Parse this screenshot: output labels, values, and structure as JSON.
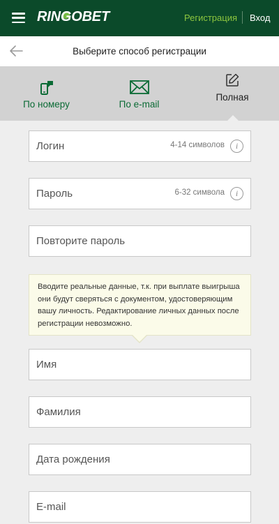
{
  "header": {
    "logo_left": "RIN",
    "logo_o": "GO",
    "logo_right": "BET",
    "register_label": "Регистрация",
    "login_label": "Вход"
  },
  "subheader": {
    "title": "Выберите способ регистрации"
  },
  "tabs": [
    {
      "label": "По номеру",
      "icon": "phone-icon"
    },
    {
      "label": "По e-mail",
      "icon": "envelope-icon"
    },
    {
      "label": "Полная",
      "icon": "edit-icon",
      "active": true
    }
  ],
  "form": {
    "login": {
      "placeholder": "Логин",
      "hint": "4-14 символов"
    },
    "password": {
      "placeholder": "Пароль",
      "hint": "6-32 символа"
    },
    "password_repeat": {
      "placeholder": "Повторите пароль"
    },
    "notice": "Вводите реальные данные, т.к. при выплате выигрыша они будут сверяться с документом, удостоверяющим вашу личность. Редактирование личных данных после регистрации невозможно.",
    "first_name": {
      "placeholder": "Имя"
    },
    "last_name": {
      "placeholder": "Фамилия"
    },
    "birth_date": {
      "placeholder": "Дата рождения"
    },
    "email": {
      "placeholder": "E-mail"
    }
  },
  "colors": {
    "header_bg": "#0b4a2a",
    "accent_green": "#8dc63f",
    "tab_green": "#0b6b35",
    "tabs_bg": "#d2d2d2",
    "notice_bg": "#fbfbe9"
  }
}
